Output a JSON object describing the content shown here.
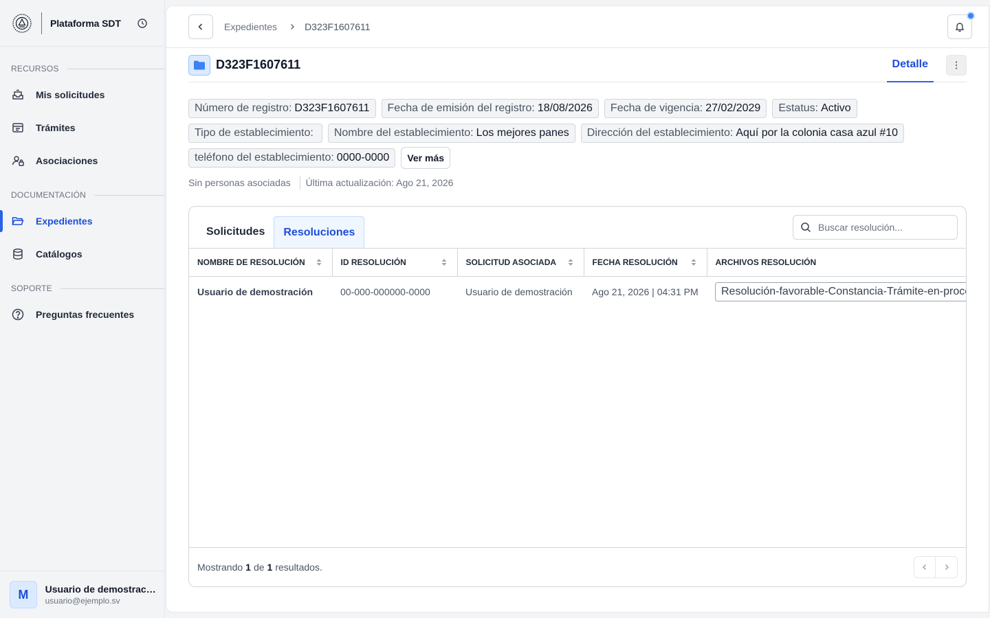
{
  "brand": {
    "name": "Plataforma SDT"
  },
  "sidebar": {
    "sections": [
      {
        "label": "RECURSOS"
      },
      {
        "label": "DOCUMENTACIÓN"
      },
      {
        "label": "SOPORTE"
      }
    ],
    "items": [
      {
        "label": "Mis solicitudes",
        "icon": "inbox-icon"
      },
      {
        "label": "Trámites",
        "icon": "form-icon"
      },
      {
        "label": "Asociaciones",
        "icon": "user-lock-icon"
      },
      {
        "label": "Expedientes",
        "icon": "folder-open-icon",
        "active": true
      },
      {
        "label": "Catálogos",
        "icon": "database-icon"
      },
      {
        "label": "Preguntas frecuentes",
        "icon": "help-circle-icon"
      }
    ]
  },
  "user": {
    "initial": "M",
    "name": "Usuario de demostración",
    "email": "usuario@ejemplo.sv"
  },
  "breadcrumb": {
    "parent": "Expedientes",
    "current": "D323F1607611"
  },
  "header": {
    "title": "D323F1607611",
    "detail_tab": "Detalle"
  },
  "chips": [
    {
      "label": "Número de registro:",
      "value": "D323F1607611"
    },
    {
      "label": "Fecha de emisión del registro:",
      "value": "18/08/2026"
    },
    {
      "label": "Fecha de vigencia:",
      "value": "27/02/2029"
    },
    {
      "label": "Estatus:",
      "value": "Activo"
    },
    {
      "label": "Tipo de establecimiento:",
      "value": ""
    },
    {
      "label": "Nombre del establecimiento:",
      "value": "Los mejores panes"
    },
    {
      "label": "Dirección del establecimiento:",
      "value": "Aquí por la colonia casa azul #10"
    },
    {
      "label": "teléfono del establecimiento:",
      "value": "0000-0000"
    }
  ],
  "ver_mas": "Ver más",
  "meta": {
    "persons": "Sin personas asociadas",
    "updated": "Última actualización: Ago 21, 2026"
  },
  "tabs": [
    {
      "label": "Solicitudes"
    },
    {
      "label": "Resoluciones",
      "active": true
    }
  ],
  "search": {
    "placeholder": "Buscar resolución..."
  },
  "table": {
    "columns": [
      "NOMBRE DE RESOLUCIÓN",
      "ID RESOLUCIÓN",
      "SOLICITUD ASOCIADA",
      "FECHA RESOLUCIÓN",
      "ARCHIVOS RESOLUCIÓN"
    ],
    "rows": [
      {
        "name": "Usuario de demostración",
        "id": "00-000-000000-0000",
        "request": "Usuario de demostración",
        "date": "Ago 21, 2026 | 04:31 PM",
        "file": "Resolución-favorable-Constancia-Trámite-en-proceso.pdf"
      }
    ]
  },
  "footer": {
    "prefix": "Mostrando",
    "from": "1",
    "middle": "de",
    "total": "1",
    "suffix": "resultados."
  },
  "colors": {
    "accent": "#2563eb",
    "accent_text": "#1d4ed8",
    "notification_dot": "#3b82f6"
  }
}
